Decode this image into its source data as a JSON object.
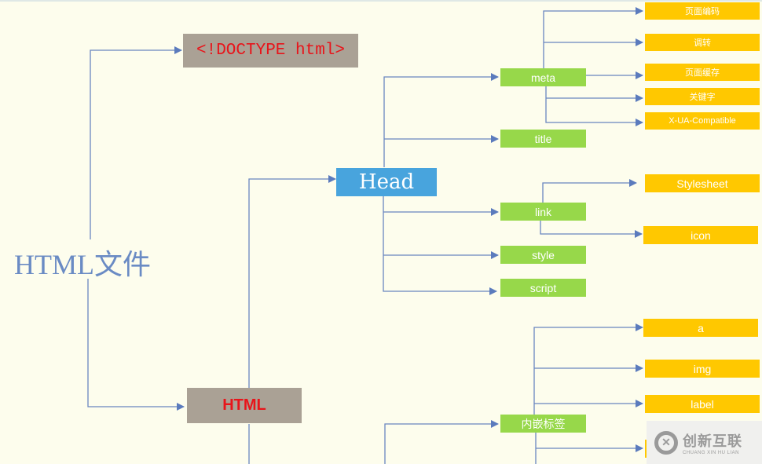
{
  "diagram": {
    "root": "HTML文件",
    "doctype": "<!DOCTYPE html>",
    "html": "HTML",
    "head": "Head",
    "head_children": {
      "meta": "meta",
      "title": "title",
      "link": "link",
      "style": "style",
      "script": "script"
    },
    "meta_children": [
      "页面编码",
      "调转",
      "页面缓存",
      "关键字",
      "X-UA-Compatible"
    ],
    "link_children": [
      "Stylesheet",
      "icon"
    ],
    "inline_tags": "内嵌标签",
    "inline_children": [
      "a",
      "img",
      "label",
      ""
    ]
  },
  "colors": {
    "background": "#fdfded",
    "connector": "#6a86c0",
    "gray_box": "#aaa195",
    "head_box": "#48a4dd",
    "green_box": "#97d84a",
    "yellow_box": "#ffc800",
    "red_text": "#e8141a"
  },
  "watermark": {
    "cn": "创新互联",
    "en": "CHUANG XIN HU LIAN"
  }
}
